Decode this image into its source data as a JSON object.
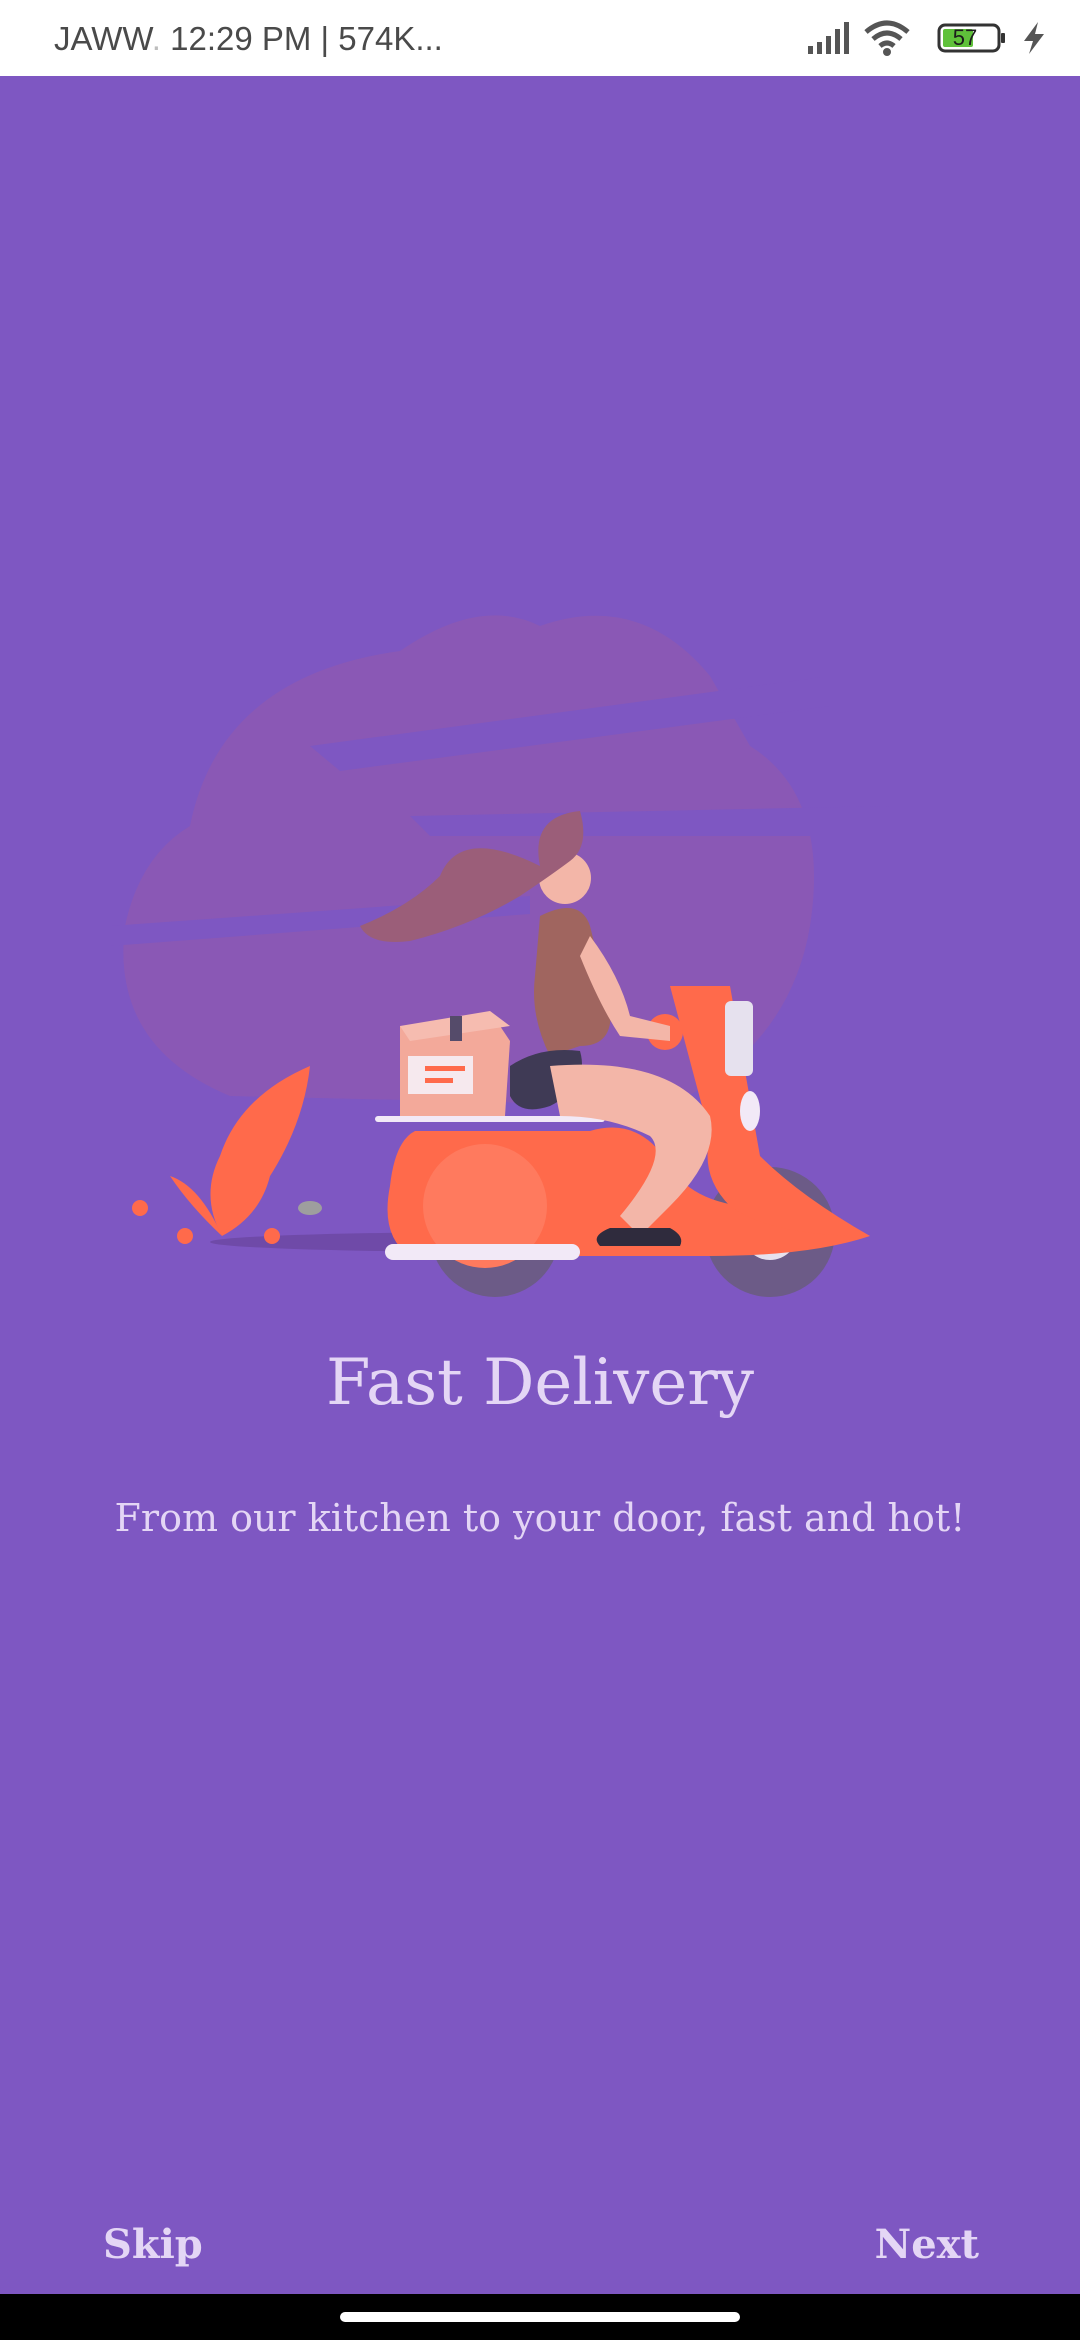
{
  "status_bar": {
    "carrier": "JAWW",
    "carrier_fade": ".",
    "time_info": "12:29 PM | 574K...",
    "battery_level": "57",
    "icons": [
      "signal-icon",
      "wifi-icon",
      "battery-icon",
      "charging-icon"
    ]
  },
  "onboarding": {
    "title": "Fast Delivery",
    "subtitle": "From our kitchen to your door, fast and hot!",
    "illustration": "delivery-scooter-illustration"
  },
  "navigation": {
    "skip_label": "Skip",
    "next_label": "Next"
  },
  "colors": {
    "background": "#7e57c2",
    "text": "#e4d6f5",
    "accent": "#ff6a4b"
  }
}
